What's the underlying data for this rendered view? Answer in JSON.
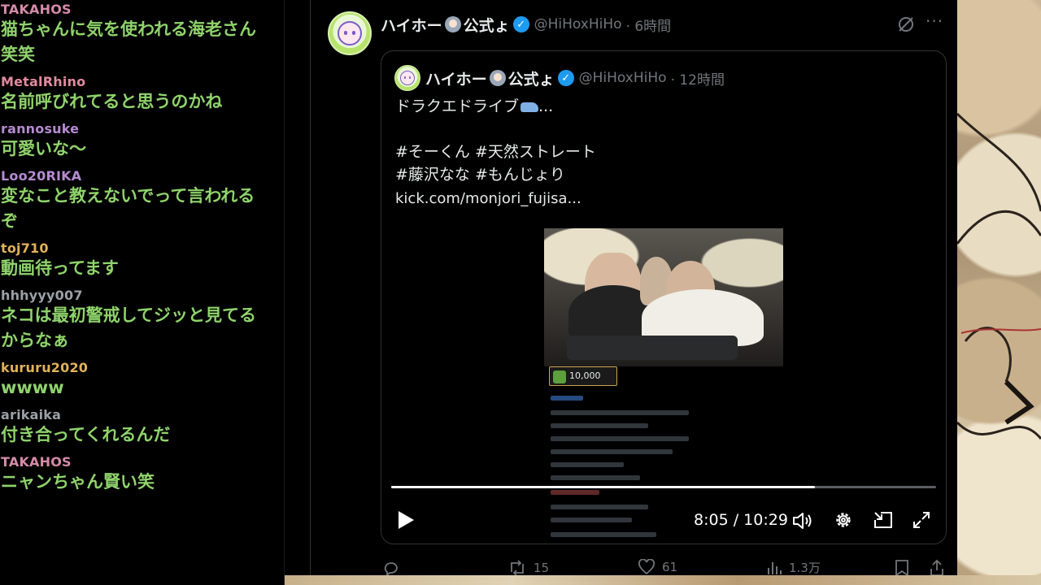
{
  "chat": {
    "messages": [
      {
        "user": "TAKAHOS",
        "color": "#d58ba8",
        "text": "猫ちゃんに気を使われる海老さん笑笑"
      },
      {
        "user": "MetalRhino",
        "color": "#e08aa0",
        "text": "名前呼びれてると思うのかね"
      },
      {
        "user": "rannosuke",
        "color": "#b58ad0",
        "text": "可愛いな〜"
      },
      {
        "user": "Loo20RIKA",
        "color": "#b58ad0",
        "text": "変なこと教えないでって言われるぞ"
      },
      {
        "user": "toj710",
        "color": "#e0b25a",
        "text": "動画待ってます"
      },
      {
        "user": "hhhyyy007",
        "color": "#9aa0a6",
        "text": "ネコは最初警戒してジッと見てるからなぁ"
      },
      {
        "user": "kururu2020",
        "color": "#e0b25a",
        "text": "wwww"
      },
      {
        "user": "arikaika",
        "color": "#9aa0a6",
        "text": "付き合ってくれるんだ"
      },
      {
        "user": "TAKAHOS",
        "color": "#d58ba8",
        "text": "ニャンちゃん賢い笑"
      }
    ]
  },
  "tweet": {
    "author_name": "ハイホー",
    "author_name_suffix": "公式ょ",
    "handle": "@HiHoxHiHo",
    "time": "· 6時間",
    "quote": {
      "author_name": "ハイホー",
      "author_name_suffix": "公式ょ",
      "handle": "@HiHoxHiHo",
      "time": "· 12時間",
      "line1": "ドラクエドライブ",
      "line1_tail": "...",
      "hashtags1": "#そーくん #天然ストレート",
      "hashtags2": "#藤沢なな #もんじょり",
      "link": "kick.com/monjori_fujisa..."
    },
    "video": {
      "badge_value": "10,000",
      "progress": 0.777,
      "time": "8:05 / 10:29"
    },
    "actions": {
      "retweets": "15",
      "likes": "61",
      "views": "1.3万"
    }
  }
}
